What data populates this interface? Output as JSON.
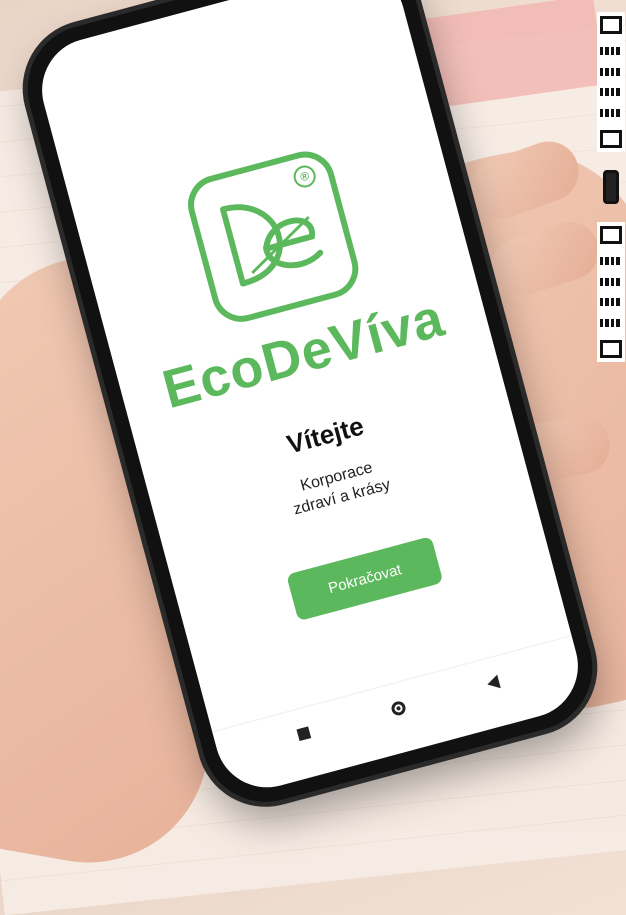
{
  "app": {
    "brand_name": "EcoDeVíva",
    "logo_letters": "De",
    "registered_symbol": "®"
  },
  "welcome": {
    "title": "Vítejte",
    "subtitle_line1": "Korporace",
    "subtitle_line2": "zdraví a krásy"
  },
  "actions": {
    "continue_label": "Pokračovat"
  },
  "navigation": {
    "items": [
      "square-nav-icon",
      "circle-nav-icon",
      "triangle-nav-icon"
    ]
  },
  "colors": {
    "brand_green": "#5cb85c",
    "text_dark": "#111111",
    "screen_bg": "#ffffff"
  }
}
